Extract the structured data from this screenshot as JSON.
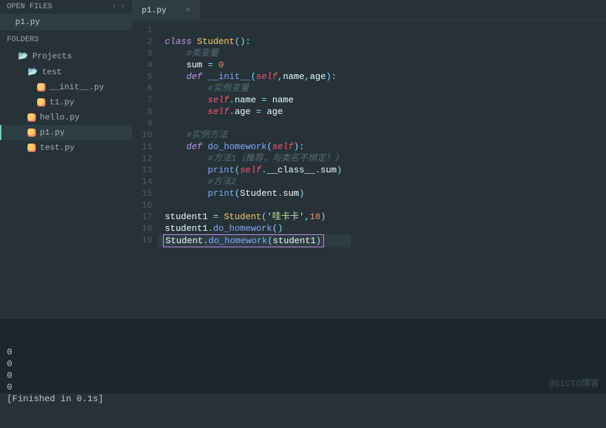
{
  "sidebar": {
    "open_files_label": "OPEN FILES",
    "open_files": [
      {
        "name": "p1.py"
      }
    ],
    "folders_label": "FOLDERS",
    "tree": {
      "root": "Projects",
      "children": [
        {
          "name": "test",
          "type": "folder",
          "children": [
            {
              "name": "__init__.py",
              "type": "py"
            },
            {
              "name": "t1.py",
              "type": "py"
            }
          ]
        },
        {
          "name": "hello.py",
          "type": "py"
        },
        {
          "name": "p1.py",
          "type": "py",
          "active": true
        },
        {
          "name": "test.py",
          "type": "py"
        }
      ]
    }
  },
  "tabs": [
    {
      "label": "p1.py",
      "active": true
    }
  ],
  "code": {
    "lines": [
      {
        "n": 1,
        "tokens": []
      },
      {
        "n": 2,
        "tokens": [
          [
            "kw",
            "class "
          ],
          [
            "cls",
            "Student"
          ],
          [
            "punc",
            "():"
          ]
        ]
      },
      {
        "n": 3,
        "tokens": [
          [
            "",
            "    "
          ],
          [
            "cmt",
            "#类变量"
          ]
        ]
      },
      {
        "n": 4,
        "tokens": [
          [
            "",
            "    "
          ],
          [
            "ident",
            "sum"
          ],
          [
            "op",
            " = "
          ],
          [
            "num",
            "0"
          ]
        ]
      },
      {
        "n": 5,
        "tokens": [
          [
            "",
            "    "
          ],
          [
            "kw",
            "def "
          ],
          [
            "fn",
            "__init__"
          ],
          [
            "punc",
            "("
          ],
          [
            "self",
            "self"
          ],
          [
            "punc",
            ","
          ],
          [
            "ident",
            "name"
          ],
          [
            "punc",
            ","
          ],
          [
            "ident",
            "age"
          ],
          [
            "punc",
            "):"
          ]
        ]
      },
      {
        "n": 6,
        "tokens": [
          [
            "",
            "        "
          ],
          [
            "cmt",
            "#实例变量"
          ]
        ]
      },
      {
        "n": 7,
        "tokens": [
          [
            "",
            "        "
          ],
          [
            "self",
            "self"
          ],
          [
            "punc",
            "."
          ],
          [
            "ident",
            "name"
          ],
          [
            "op",
            " = "
          ],
          [
            "ident",
            "name"
          ]
        ]
      },
      {
        "n": 8,
        "tokens": [
          [
            "",
            "        "
          ],
          [
            "self",
            "self"
          ],
          [
            "punc",
            "."
          ],
          [
            "ident",
            "age"
          ],
          [
            "op",
            " = "
          ],
          [
            "ident",
            "age"
          ]
        ]
      },
      {
        "n": 9,
        "tokens": []
      },
      {
        "n": 10,
        "tokens": [
          [
            "",
            "    "
          ],
          [
            "cmt",
            "#实例方法"
          ]
        ]
      },
      {
        "n": 11,
        "tokens": [
          [
            "",
            "    "
          ],
          [
            "kw",
            "def "
          ],
          [
            "fn",
            "do_homework"
          ],
          [
            "punc",
            "("
          ],
          [
            "self",
            "self"
          ],
          [
            "punc",
            "):"
          ]
        ]
      },
      {
        "n": 12,
        "tokens": [
          [
            "",
            "        "
          ],
          [
            "cmt",
            "#方法1（推荐，与类名不绑定！）"
          ]
        ]
      },
      {
        "n": 13,
        "tokens": [
          [
            "",
            "        "
          ],
          [
            "fn",
            "print"
          ],
          [
            "punc",
            "("
          ],
          [
            "self",
            "self"
          ],
          [
            "punc",
            "."
          ],
          [
            "ident",
            "__class__"
          ],
          [
            "punc",
            "."
          ],
          [
            "ident",
            "sum"
          ],
          [
            "punc",
            ")"
          ]
        ]
      },
      {
        "n": 14,
        "tokens": [
          [
            "",
            "        "
          ],
          [
            "cmt",
            "#方法2"
          ]
        ]
      },
      {
        "n": 15,
        "tokens": [
          [
            "",
            "        "
          ],
          [
            "fn",
            "print"
          ],
          [
            "punc",
            "("
          ],
          [
            "ident",
            "Student"
          ],
          [
            "punc",
            "."
          ],
          [
            "ident",
            "sum"
          ],
          [
            "punc",
            ")"
          ]
        ]
      },
      {
        "n": 16,
        "tokens": []
      },
      {
        "n": 17,
        "tokens": [
          [
            "ident",
            "student1"
          ],
          [
            "op",
            " = "
          ],
          [
            "cls",
            "Student"
          ],
          [
            "punc",
            "("
          ],
          [
            "str",
            "'哇卡卡'"
          ],
          [
            "punc",
            ","
          ],
          [
            "num",
            "18"
          ],
          [
            "punc",
            ")"
          ]
        ]
      },
      {
        "n": 18,
        "tokens": [
          [
            "ident",
            "student1"
          ],
          [
            "punc",
            "."
          ],
          [
            "fn",
            "do_homework"
          ],
          [
            "punc",
            "()"
          ]
        ]
      },
      {
        "n": 19,
        "hl": true,
        "box": true,
        "tokens": [
          [
            "ident",
            "Student"
          ],
          [
            "punc",
            "."
          ],
          [
            "fn",
            "do_homework"
          ],
          [
            "punc",
            "("
          ],
          [
            "ident",
            "student1"
          ],
          [
            "punc",
            ")"
          ]
        ]
      }
    ]
  },
  "console": {
    "lines": [
      "0",
      "0",
      "0",
      "0",
      "[Finished in 0.1s]"
    ]
  },
  "watermark": "@51CTO博客"
}
